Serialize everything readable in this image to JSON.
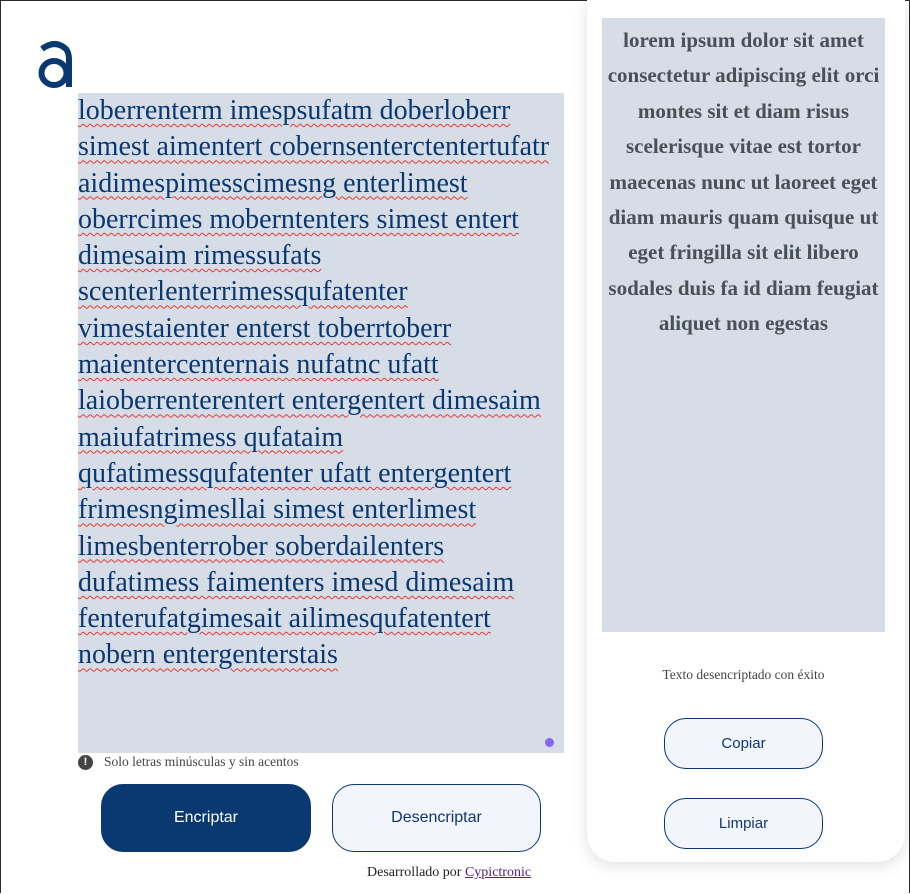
{
  "brand": {
    "logo_letter": "a",
    "accent": "#0a3871"
  },
  "encrypt_input": {
    "value": "loberrenterm imespsufatm doberloberr simest aimentert cobernsenterctentertufatr aidimespimesscimesng enterlimest oberrcimes moberntenters simest entert dimesaim rimessufats scenterlenterrimessqufatenter vimestaienter enterst toberrtoberr maientercenternais nufatnc ufatt laioberrenterentert entergentert dimesaim maiufatrimess qufataim qufatimessqufatenter ufatt entergentert frimesngimesllai simest enterlimest limesbenterrober soberdailenters dufatimess faimenters imesd dimesaim fenterufatgimesait ailimesqufatentert nobern entergenterstais"
  },
  "hint": {
    "icon": "exclamation-circle-icon",
    "text": "Solo letras minúsculas y sin acentos"
  },
  "buttons": {
    "encrypt": "Encriptar",
    "decrypt": "Desencriptar",
    "copy": "Copiar",
    "clear": "Limpiar"
  },
  "output": {
    "text": "lorem ipsum dolor sit amet consectetur adipiscing elit orci montes sit et diam risus scelerisque vitae est tortor maecenas nunc ut laoreet eget diam mauris quam quisque ut eget fringilla sit elit libero sodales duis fa id diam feugiat aliquet non egestas",
    "status": "Texto desencriptado con éxito"
  },
  "footer": {
    "prefix": "Desarrollado por",
    "link": "Cypictronic"
  }
}
